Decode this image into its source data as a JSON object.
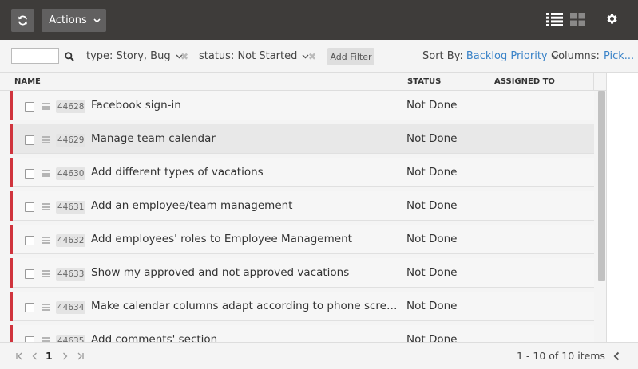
{
  "toolbar": {
    "actions_label": "Actions"
  },
  "filters": {
    "search_value": "",
    "type_filter": "type: Story, Bug",
    "status_filter": "status: Not Started",
    "add_filter_label": "Add Filter",
    "sort_label": "Sort By:",
    "sort_value": "Backlog Priority",
    "columns_label": "Columns:",
    "columns_value": "Pick..."
  },
  "table": {
    "headers": {
      "name": "NAME",
      "status": "STATUS",
      "assigned": "ASSIGNED TO"
    },
    "rows": [
      {
        "id": "44628",
        "title": "Facebook sign-in",
        "status": "Not Done",
        "assigned": ""
      },
      {
        "id": "44629",
        "title": "Manage team calendar",
        "status": "Not Done",
        "assigned": ""
      },
      {
        "id": "44630",
        "title": "Add different types of vacations",
        "status": "Not Done",
        "assigned": ""
      },
      {
        "id": "44631",
        "title": "Add an employee/team management",
        "status": "Not Done",
        "assigned": ""
      },
      {
        "id": "44632",
        "title": "Add employees' roles to Employee Management",
        "status": "Not Done",
        "assigned": ""
      },
      {
        "id": "44633",
        "title": "Show my approved and not approved vacations",
        "status": "Not Done",
        "assigned": ""
      },
      {
        "id": "44634",
        "title": "Make calendar columns adapt according to phone screen orientation",
        "status": "Not Done",
        "assigned": ""
      },
      {
        "id": "44635",
        "title": "Add comments' section",
        "status": "Not Done",
        "assigned": ""
      }
    ]
  },
  "pagination": {
    "current_page": "1",
    "count_text": "1 - 10 of 10 items"
  },
  "colors": {
    "topbar": "#3e3c3a",
    "priority_bar": "#d0343d",
    "link": "#3a83c8"
  }
}
